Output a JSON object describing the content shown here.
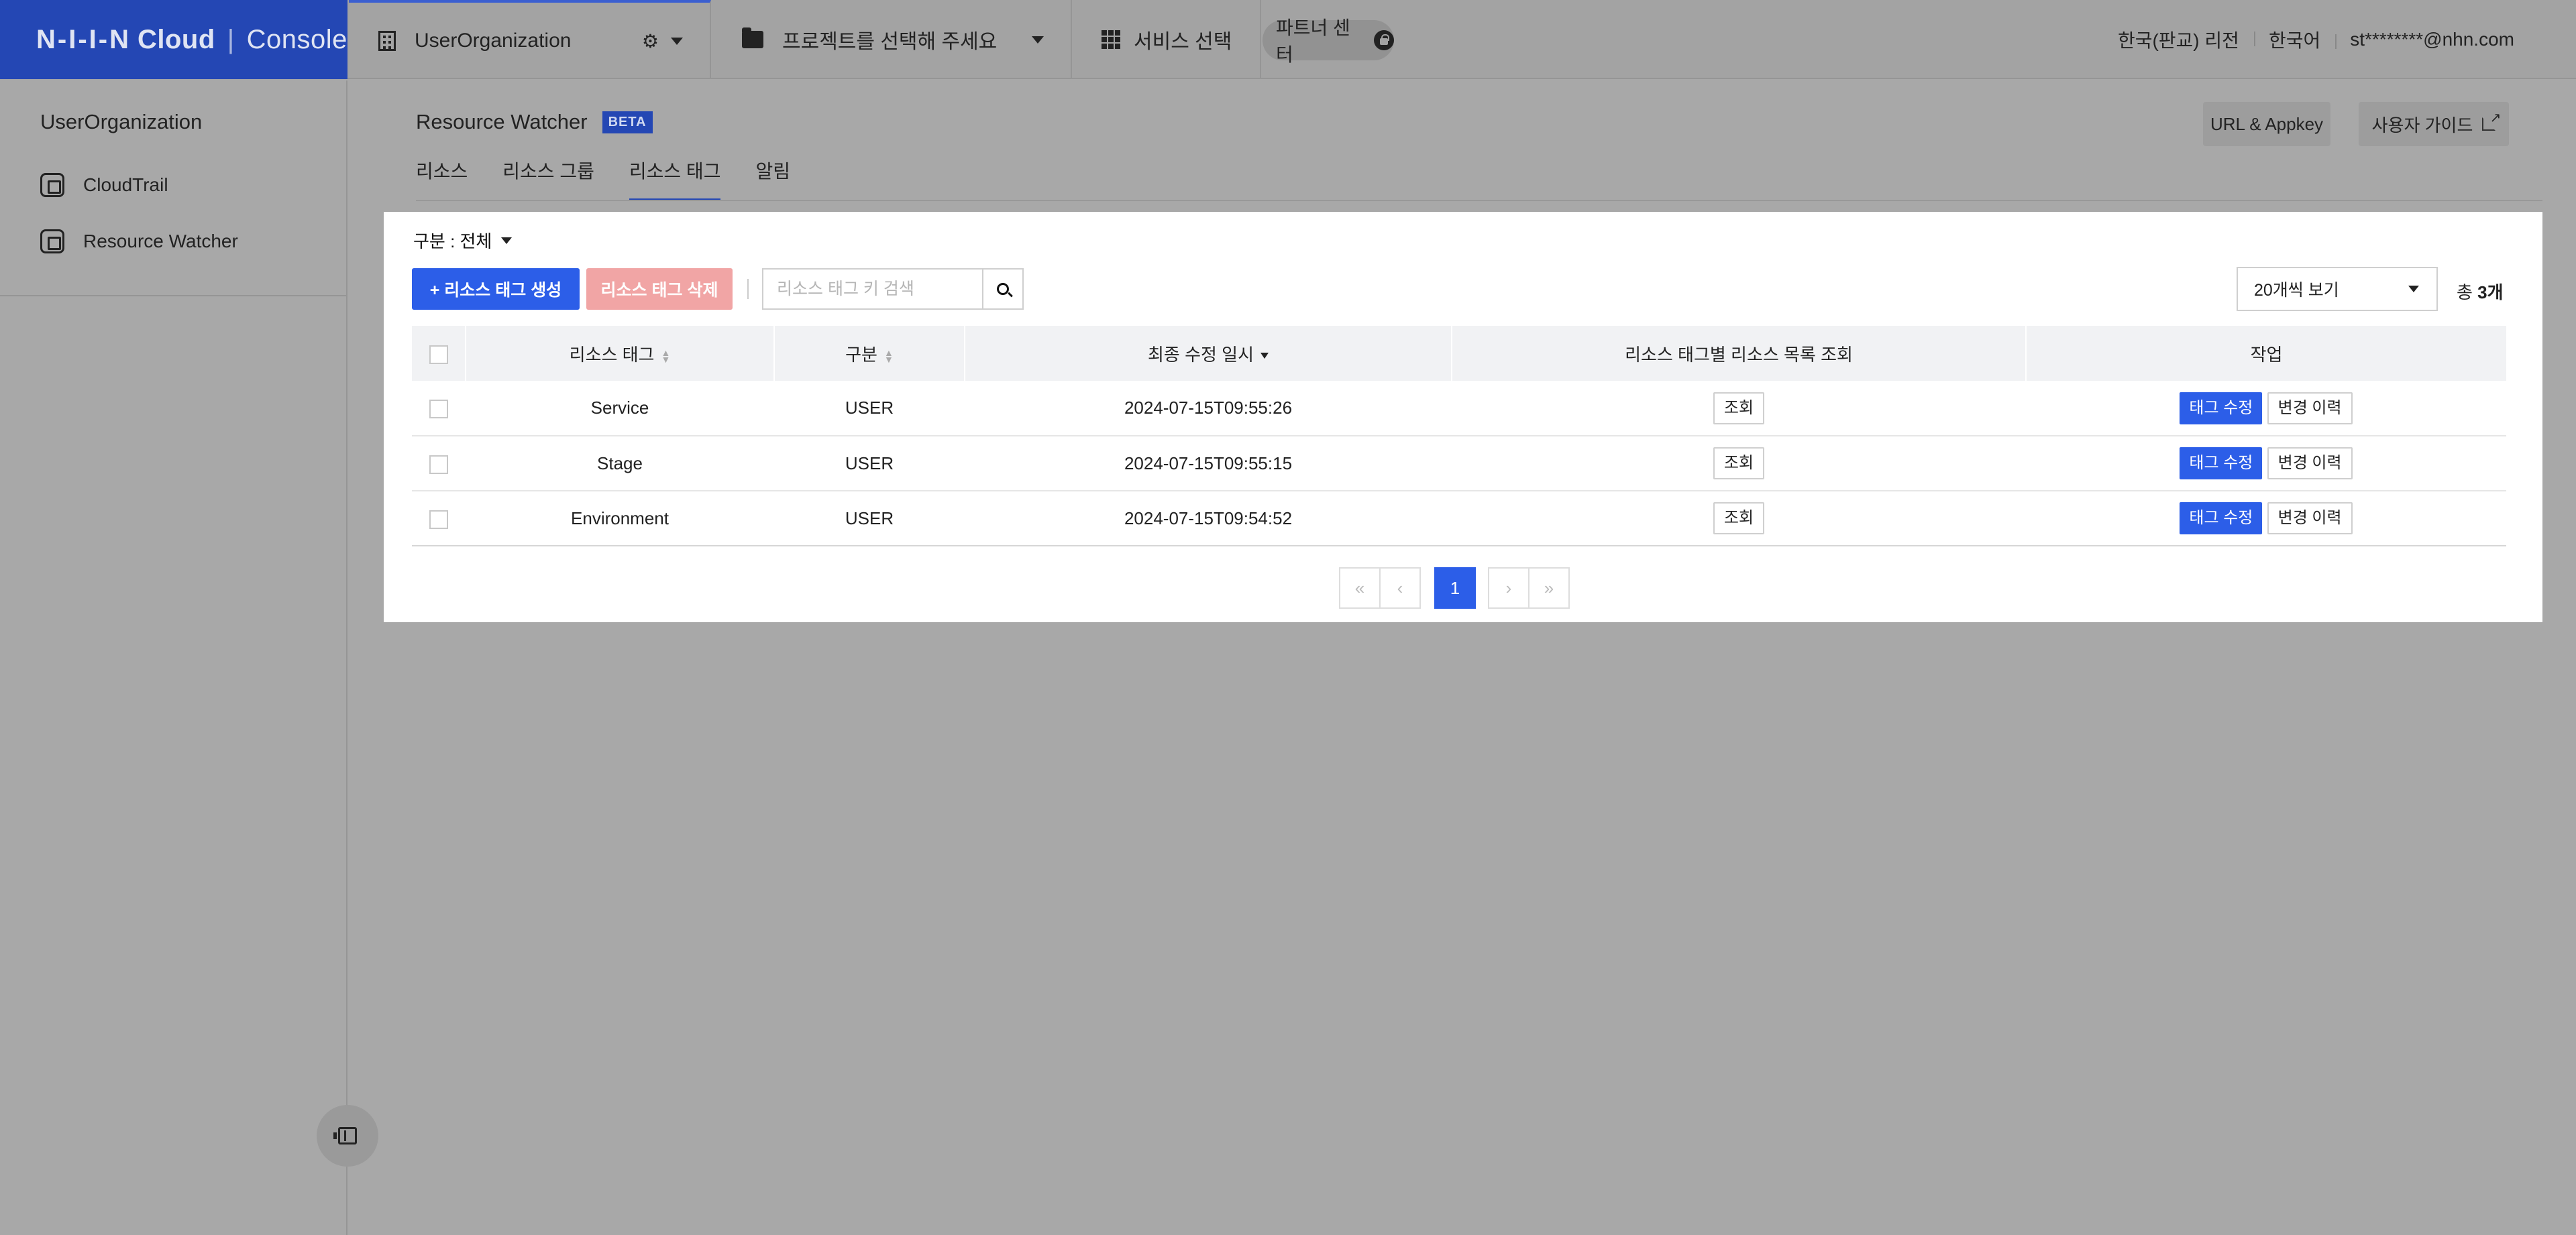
{
  "logo": {
    "nhn": "N-I-I-N",
    "cloud": "Cloud",
    "console": "Console"
  },
  "topbar": {
    "organization": "UserOrganization",
    "project_placeholder": "프로젝트를 선택해 주세요",
    "service_select": "서비스 선택",
    "partner_center": "파트너 센터",
    "region": "한국(판교) 리전",
    "language": "한국어",
    "user": "st********@nhn.com"
  },
  "sidebar": {
    "org_title": "UserOrganization",
    "items": [
      {
        "label": "CloudTrail",
        "icon": "chip-icon"
      },
      {
        "label": "Resource Watcher",
        "icon": "chip-icon"
      }
    ]
  },
  "header": {
    "title": "Resource Watcher",
    "badge": "BETA",
    "url_appkey": "URL & Appkey",
    "user_guide": "사용자 가이드"
  },
  "tabs": [
    {
      "label": "리소스",
      "active": false
    },
    {
      "label": "리소스 그룹",
      "active": false
    },
    {
      "label": "리소스 태그",
      "active": true
    },
    {
      "label": "알림",
      "active": false
    }
  ],
  "toolbar": {
    "filter": "구분 : 전체",
    "create": "+ 리소스 태그 생성",
    "delete": "리소스 태그 삭제",
    "search_placeholder": "리소스 태그 키 검색",
    "per_page": "20개씩 보기",
    "total_prefix": "총 ",
    "total_count": "3개"
  },
  "table": {
    "headers": [
      "리소스 태그",
      "구분",
      "최종 수정 일시",
      "리소스 태그별 리소스 목록 조회",
      "작업"
    ],
    "rows": [
      {
        "tag": "Service",
        "type": "USER",
        "modified": "2024-07-15T09:55:26",
        "view": "조회",
        "edit": "태그 수정",
        "history": "변경 이력"
      },
      {
        "tag": "Stage",
        "type": "USER",
        "modified": "2024-07-15T09:55:15",
        "view": "조회",
        "edit": "태그 수정",
        "history": "변경 이력"
      },
      {
        "tag": "Environment",
        "type": "USER",
        "modified": "2024-07-15T09:54:52",
        "view": "조회",
        "edit": "태그 수정",
        "history": "변경 이력"
      }
    ]
  },
  "pagination": {
    "first": "«",
    "prev": "‹",
    "current": "1",
    "next": "›",
    "last": "»"
  },
  "colors": {
    "brand": "#2447b4",
    "primary_button": "#2c5ee8",
    "overlay": "#a8a8a8"
  }
}
